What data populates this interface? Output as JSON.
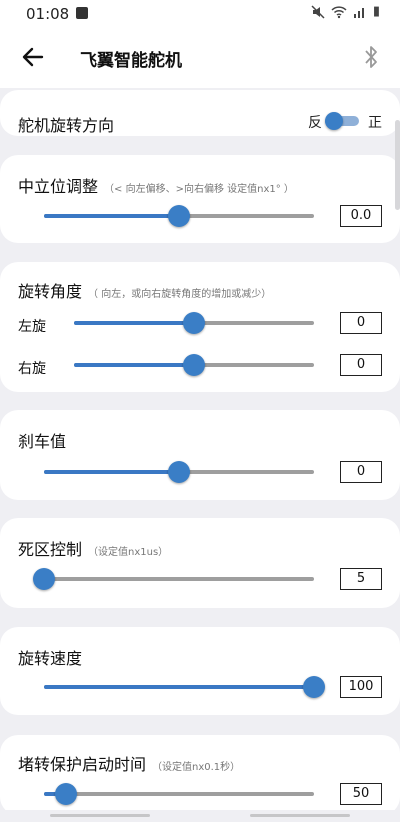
{
  "status": {
    "time": "01:08",
    "battery": "▮"
  },
  "app": {
    "title": "飞翼智能舵机"
  },
  "direction": {
    "title": "舵机旋转方向",
    "left": "反",
    "right": "正",
    "state": "反"
  },
  "center": {
    "title": "中立位调整",
    "hint": "（< 向左偏移、>向右偏移 设定值nx1° ）",
    "value": "0.0",
    "fraction": 0.5
  },
  "angle": {
    "title": "旋转角度",
    "hint": "（ 向左，或向右旋转角度的增加或减少）",
    "left_label": "左旋",
    "left_value": "0",
    "left_fraction": 0.5,
    "right_label": "右旋",
    "right_value": "0",
    "right_fraction": 0.5
  },
  "brake": {
    "title": "刹车值",
    "value": "0",
    "fraction": 0.5
  },
  "deadzone": {
    "title": "死区控制",
    "hint": "（设定值nx1us）",
    "value": "5",
    "fraction": 0.0
  },
  "speed": {
    "title": "旋转速度",
    "value": "100",
    "fraction": 1.0
  },
  "stall": {
    "title": "堵转保护启动时间",
    "hint": "（设定值nx0.1秒）",
    "value": "50",
    "fraction": 0.08
  },
  "colors": {
    "accent": "#3a7ec6",
    "track": "#9e9e9e",
    "card": "#ffffff",
    "background": "#efeff3"
  }
}
